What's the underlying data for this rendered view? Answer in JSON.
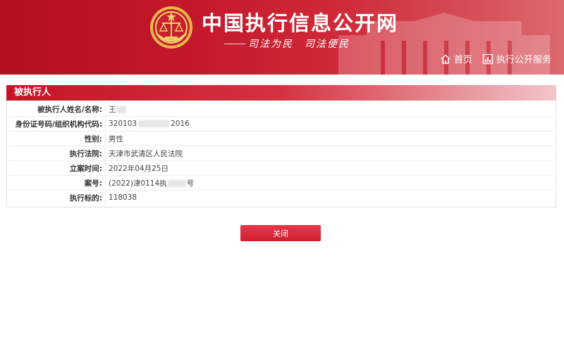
{
  "header": {
    "site_title": "中国执行信息公开网",
    "slogan": "司法为民　司法便民",
    "nav": [
      {
        "label": "首页",
        "icon": "home-icon"
      },
      {
        "label": "执行公开服务",
        "icon": "bar-chart-icon"
      }
    ]
  },
  "panel": {
    "title": "被执行人",
    "rows": [
      {
        "label": "被执行人姓名/名称:",
        "value": "王"
      },
      {
        "label": "身份证号码/组织机构代码:",
        "value_prefix": "320103",
        "value_suffix": "2016"
      },
      {
        "label": "性别:",
        "value": "男性"
      },
      {
        "label": "执行法院:",
        "value": "天津市武清区人民法院"
      },
      {
        "label": "立案时间:",
        "value": "2022年04月25日"
      },
      {
        "label": "案号:",
        "value_prefix": "(2022)津0114执",
        "value_suffix": "号"
      },
      {
        "label": "执行标的:",
        "value": "118038"
      }
    ]
  },
  "close_label": "关闭",
  "colors": {
    "brand_red": "#c31526",
    "button_red": "#d92838"
  }
}
